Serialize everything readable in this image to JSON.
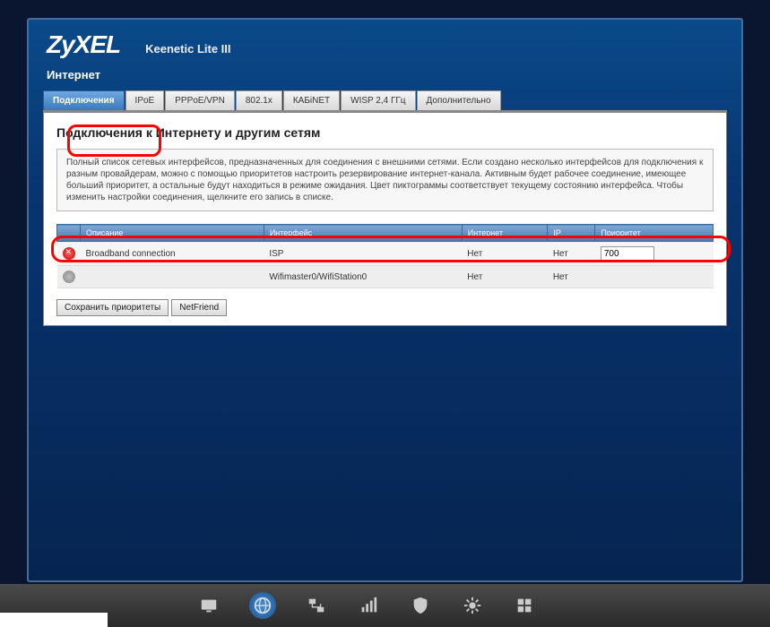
{
  "brand": "ZyXEL",
  "model": "Keenetic Lite III",
  "section": "Интернет",
  "tabs": [
    "Подключения",
    "IPoE",
    "PPPoE/VPN",
    "802.1x",
    "КАБiNET",
    "WISP 2,4 ГГц",
    "Дополнительно"
  ],
  "active_tab": 0,
  "panel": {
    "title": "Подключения к Интернету и другим сетям",
    "desc": "Полный список сетевых интерфейсов, предназначенных для соединения с внешними сетями. Если создано несколько интерфейсов для подключения к разным провайдерам, можно с помощью приоритетов настроить резервирование интернет-канала. Активным будет рабочее соединение, имеющее больший приоритет, а остальные будут находиться в режиме ожидания. Цвет пиктограммы соответствует текущему состоянию интерфейса. Чтобы изменить настройки соединения, щелкните его запись в списке.",
    "headers": [
      "",
      "Описание",
      "Интерфейс",
      "Интернет",
      "IP",
      "Приоритет"
    ],
    "rows": [
      {
        "status": "error",
        "desc": "Broadband connection",
        "iface": "ISP",
        "inet": "Нет",
        "ip": "Нет",
        "prio": "700"
      },
      {
        "status": "off",
        "desc": "",
        "iface": "Wifimaster0/WifiStation0",
        "inet": "Нет",
        "ip": "Нет",
        "prio": ""
      }
    ],
    "buttons": {
      "save": "Сохранить приоритеты",
      "netfriend": "NetFriend"
    }
  },
  "nav_icons": [
    "monitor-icon",
    "globe-icon",
    "network-icon",
    "wifi-icon",
    "shield-icon",
    "gear-icon",
    "apps-icon"
  ],
  "active_nav": 1
}
